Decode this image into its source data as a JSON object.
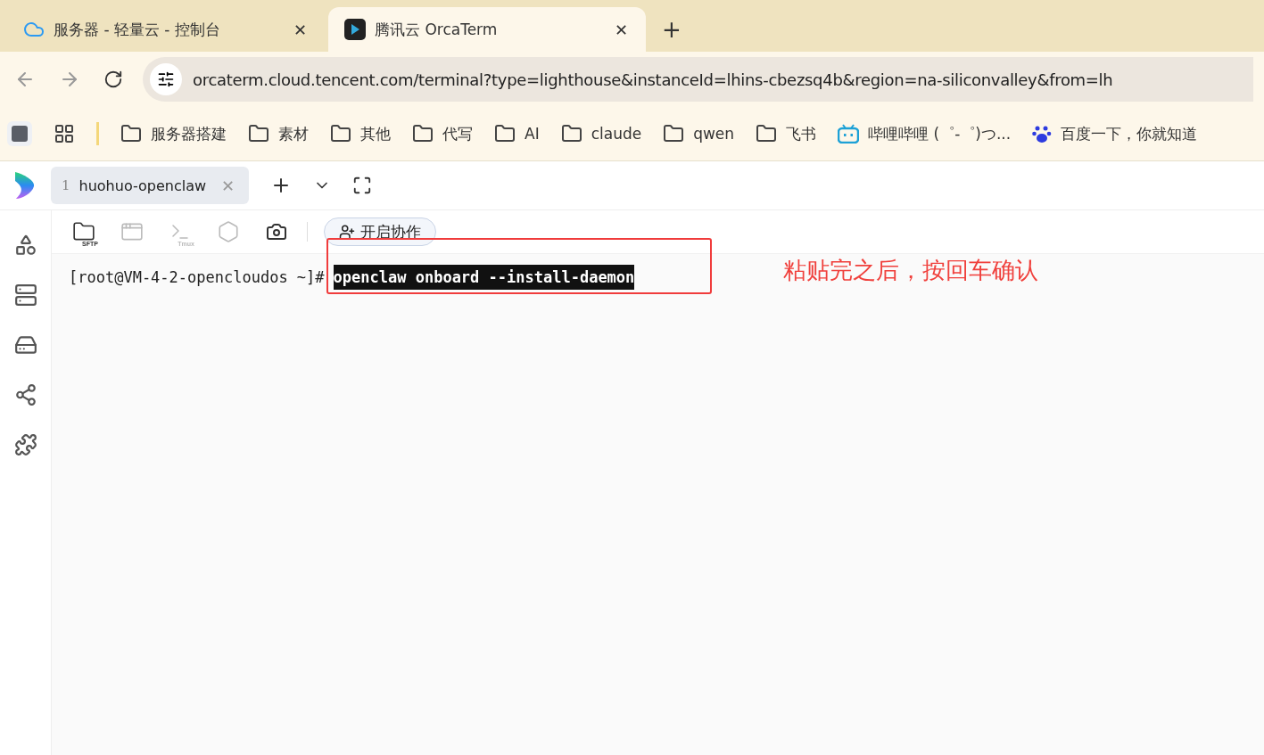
{
  "browser_tabs": [
    {
      "title": "服务器 - 轻量云 - 控制台",
      "kind": "cloud",
      "selected": false,
      "close": "✕"
    },
    {
      "title": "腾讯云 OrcaTerm",
      "kind": "orca",
      "selected": true,
      "close": "✕"
    }
  ],
  "new_tab": "+",
  "address_bar": {
    "url": "orcaterm.cloud.tencent.com/terminal?type=lighthouse&instanceId=lhins-cbezsq4b&region=na-siliconvalley&from=lh"
  },
  "bookmarks": [
    {
      "label": "服务器搭建",
      "kind": "folder"
    },
    {
      "label": "素材",
      "kind": "folder"
    },
    {
      "label": "其他",
      "kind": "folder"
    },
    {
      "label": "代写",
      "kind": "folder"
    },
    {
      "label": "AI",
      "kind": "folder"
    },
    {
      "label": "claude",
      "kind": "folder"
    },
    {
      "label": "qwen",
      "kind": "folder"
    },
    {
      "label": "飞书",
      "kind": "folder"
    },
    {
      "label": "哔哩哔哩 (゜-゜)つ...",
      "kind": "tv"
    },
    {
      "label": "百度一下，你就知道",
      "kind": "paw"
    }
  ],
  "session_tabs": [
    {
      "index": "1",
      "name": "huohuo-openclaw",
      "selected": true,
      "close": "✕"
    }
  ],
  "sidebar": [
    {
      "kind": "apps"
    },
    {
      "kind": "servers"
    },
    {
      "kind": "storage"
    },
    {
      "kind": "share"
    },
    {
      "kind": "plugin"
    }
  ],
  "toolbar": {
    "tools": [
      {
        "kind": "sftp",
        "label": "SFTP",
        "disabled": false
      },
      {
        "kind": "window",
        "disabled": true
      },
      {
        "kind": "tmux",
        "label": "Tmux",
        "disabled": true
      },
      {
        "kind": "hex",
        "disabled": true
      },
      {
        "kind": "snapshot",
        "disabled": false
      }
    ],
    "collab_button": "开启协作"
  },
  "terminal": {
    "prompt": "[root@VM-4-2-opencloudos ~]#",
    "command": "openclaw onboard --install-daemon"
  },
  "annotation": {
    "note": "粘贴完之后，按回车确认"
  }
}
